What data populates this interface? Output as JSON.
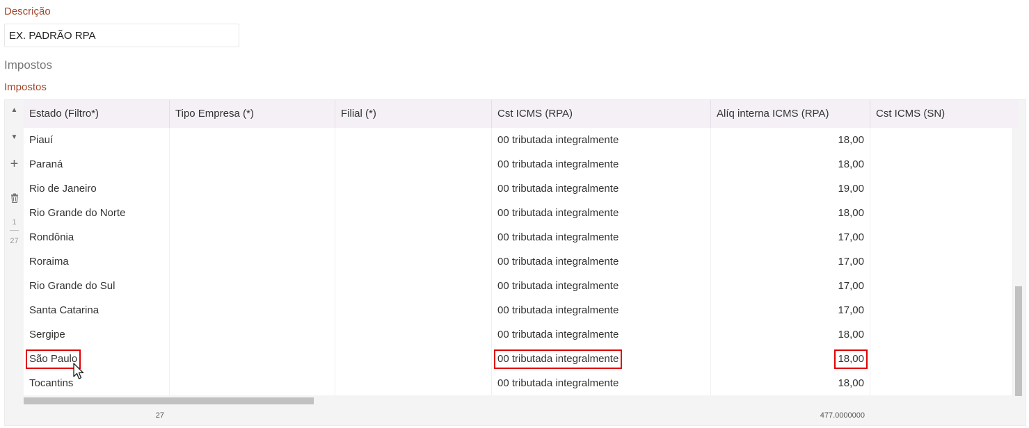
{
  "form": {
    "description_label": "Descrição",
    "description_value": "EX. PADRÃO RPA",
    "section_heading": "Impostos",
    "grid_label": "Impostos"
  },
  "grid": {
    "columns": [
      "Estado (Filtro*)",
      "Tipo Empresa (*)",
      "Filial (*)",
      "Cst ICMS (RPA)",
      "Alíq interna ICMS (RPA)",
      "Cst ICMS (SN)"
    ],
    "rows": [
      {
        "estado": "Piauí",
        "tipo": "",
        "filial": "",
        "cst": "00 tributada integralmente",
        "aliq": "18,00",
        "cst_sn": ""
      },
      {
        "estado": "Paraná",
        "tipo": "",
        "filial": "",
        "cst": "00 tributada integralmente",
        "aliq": "18,00",
        "cst_sn": ""
      },
      {
        "estado": "Rio de Janeiro",
        "tipo": "",
        "filial": "",
        "cst": "00 tributada integralmente",
        "aliq": "19,00",
        "cst_sn": ""
      },
      {
        "estado": "Rio Grande do Norte",
        "tipo": "",
        "filial": "",
        "cst": "00 tributada integralmente",
        "aliq": "18,00",
        "cst_sn": ""
      },
      {
        "estado": "Rondônia",
        "tipo": "",
        "filial": "",
        "cst": "00 tributada integralmente",
        "aliq": "17,00",
        "cst_sn": ""
      },
      {
        "estado": "Roraima",
        "tipo": "",
        "filial": "",
        "cst": "00 tributada integralmente",
        "aliq": "17,00",
        "cst_sn": ""
      },
      {
        "estado": "Rio Grande do Sul",
        "tipo": "",
        "filial": "",
        "cst": "00 tributada integralmente",
        "aliq": "17,00",
        "cst_sn": ""
      },
      {
        "estado": "Santa Catarina",
        "tipo": "",
        "filial": "",
        "cst": "00 tributada integralmente",
        "aliq": "17,00",
        "cst_sn": ""
      },
      {
        "estado": "Sergipe",
        "tipo": "",
        "filial": "",
        "cst": "00 tributada integralmente",
        "aliq": "18,00",
        "cst_sn": ""
      },
      {
        "estado": "São Paulo",
        "tipo": "",
        "filial": "",
        "cst": "00 tributada integralmente",
        "aliq": "18,00",
        "cst_sn": ""
      },
      {
        "estado": "Tocantins",
        "tipo": "",
        "filial": "",
        "cst": "00 tributada integralmente",
        "aliq": "18,00",
        "cst_sn": ""
      }
    ],
    "footer": {
      "count": "27",
      "sum": "477.0000000"
    }
  },
  "toolbar": {
    "up_icon": "caret-up-icon",
    "down_icon": "caret-down-icon",
    "add_icon": "plus-icon",
    "delete_icon": "trash-icon",
    "page": "1",
    "total": "27"
  },
  "colors": {
    "highlight": "#e00000",
    "label": "#a0472a",
    "header_bg": "#f4f0f6"
  }
}
